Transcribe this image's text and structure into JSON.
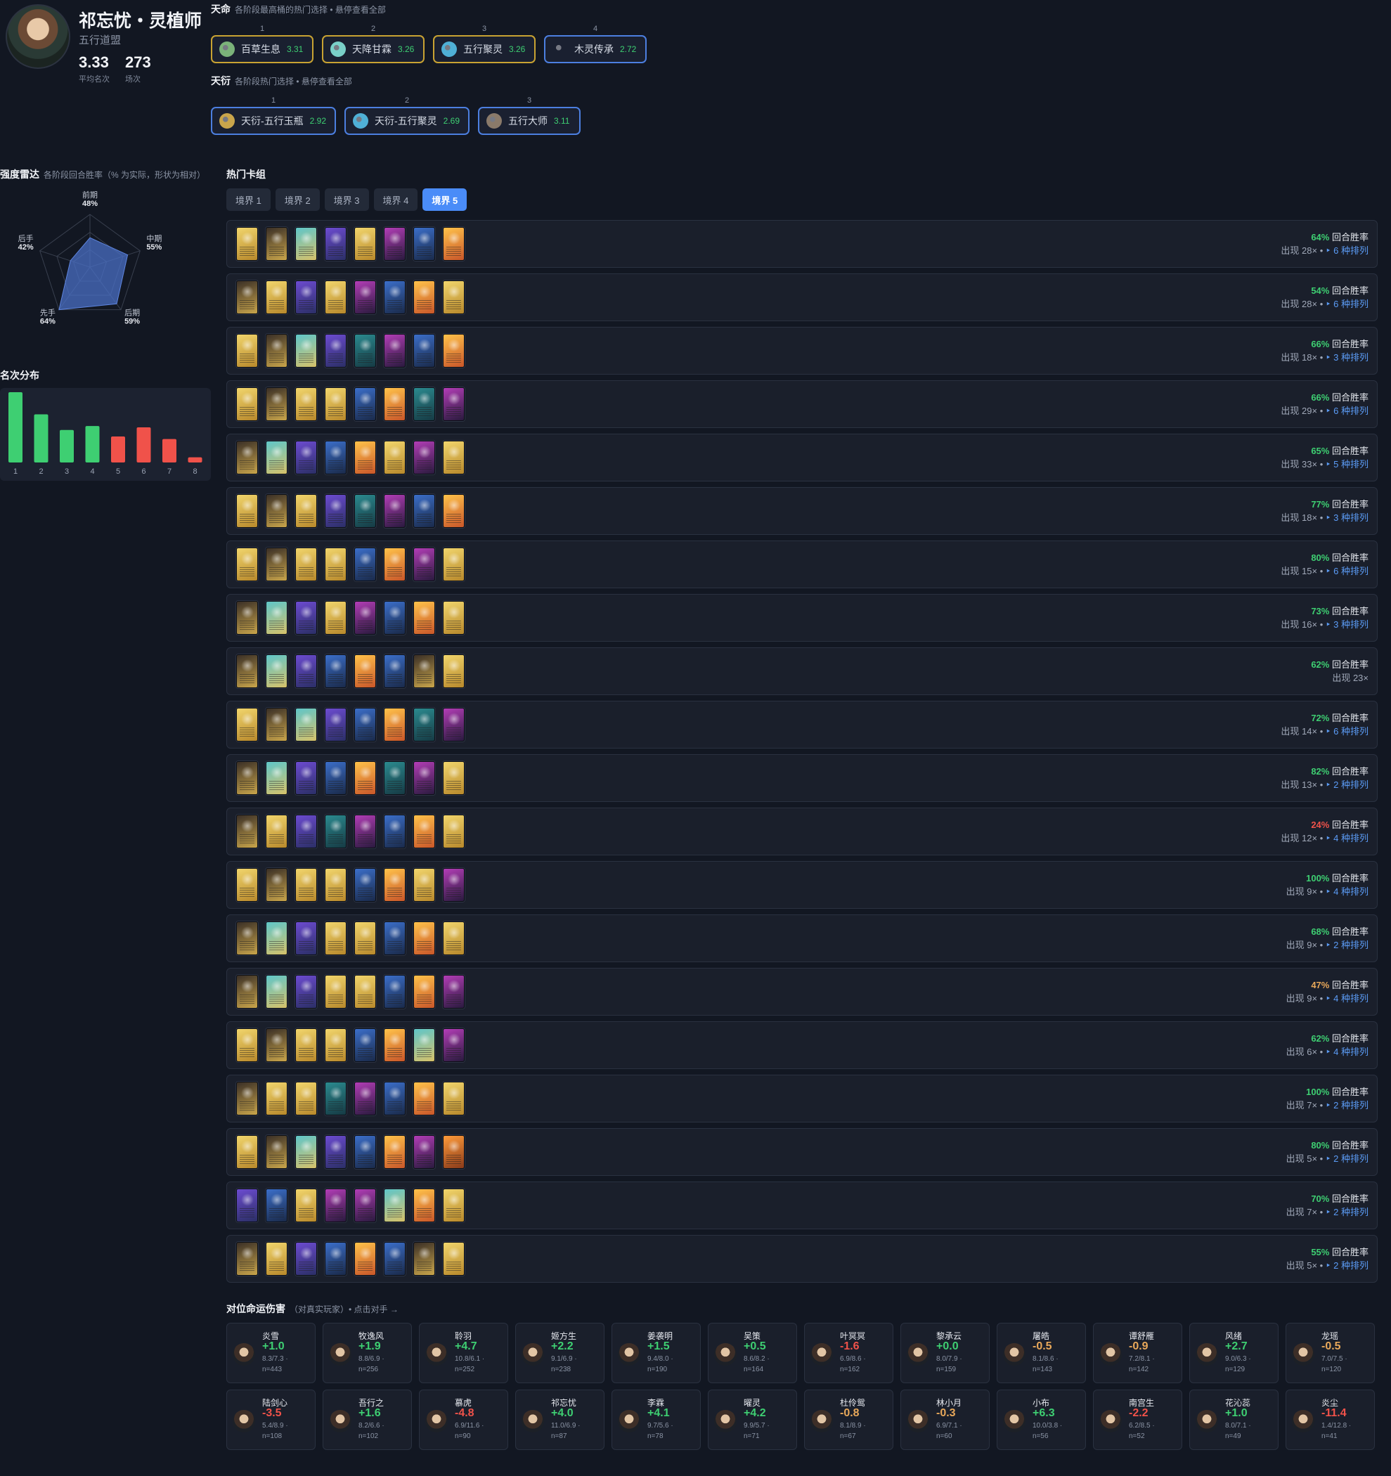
{
  "header": {
    "name": "祁忘忧・灵植师",
    "faction": "五行道盟",
    "avg_rank": "3.33",
    "avg_rank_label": "平均名次",
    "games": "273",
    "games_label": "场次"
  },
  "tianming": {
    "title": "天命",
    "subtitle": "各阶段最高桶的热门选择 • 悬停查看全部",
    "picks": [
      {
        "num": "1",
        "name": "百草生息",
        "score": "3.31",
        "icon": "herb-icon",
        "color": "#7bb37a"
      },
      {
        "num": "2",
        "name": "天降甘霖",
        "score": "3.26",
        "icon": "rain-icon",
        "color": "#7ad0c8"
      },
      {
        "num": "3",
        "name": "五行聚灵",
        "score": "3.26",
        "icon": "five-elements-icon",
        "color": "#4fb0d6"
      },
      {
        "num": "4",
        "name": "木灵传承",
        "score": "2.72",
        "icon": "wood-spirit-icon",
        "color": "#1a2030"
      }
    ]
  },
  "tianyan": {
    "title": "天衍",
    "subtitle": "各阶段热门选择 • 悬停查看全部",
    "picks": [
      {
        "num": "1",
        "name": "天衍-五行玉瓶",
        "score": "2.92",
        "icon": "jade-bottle-icon",
        "color": "#c9a54b"
      },
      {
        "num": "2",
        "name": "天衍-五行聚灵",
        "score": "2.69",
        "icon": "five-elements-icon",
        "color": "#4fb0d6"
      },
      {
        "num": "3",
        "name": "五行大师",
        "score": "3.11",
        "icon": "master-icon",
        "color": "#8a7a6a"
      }
    ]
  },
  "radar": {
    "title": "强度雷达",
    "subtitle": "各阶段回合胜率（% 为实际，形状为相对）",
    "axes": [
      {
        "label": "前期",
        "value": 48,
        "pct": "48%"
      },
      {
        "label": "中期",
        "value": 55,
        "pct": "55%"
      },
      {
        "label": "后期",
        "value": 59,
        "pct": "59%"
      },
      {
        "label": "先手",
        "value": 64,
        "pct": "64%"
      },
      {
        "label": "后手",
        "value": 42,
        "pct": "42%"
      }
    ],
    "fill": "#4a6fc4"
  },
  "placement": {
    "title": "名次分布"
  },
  "chart_data": {
    "type": "bar",
    "categories": [
      "1",
      "2",
      "3",
      "4",
      "5",
      "6",
      "7",
      "8"
    ],
    "values": [
      54,
      37,
      25,
      28,
      20,
      27,
      18,
      4
    ],
    "colors": [
      "#3ecf72",
      "#3ecf72",
      "#3ecf72",
      "#3ecf72",
      "#f0524a",
      "#f0524a",
      "#f0524a",
      "#f0524a"
    ]
  },
  "decks": {
    "title": "热门卡组",
    "tabs": [
      "境界 1",
      "境界 2",
      "境界 3",
      "境界 4",
      "境界 5"
    ],
    "active_tab": 4,
    "winrate_label": "回合胜率",
    "rows": [
      {
        "winrate": "64%",
        "color": "#3ecf72",
        "appear": "出现 28× •",
        "variants": "‣ 6 种排列",
        "cards": [
          "gold",
          "dark",
          "cyan",
          "purple",
          "gold",
          "magenta",
          "blue",
          "flame"
        ]
      },
      {
        "winrate": "54%",
        "color": "#3ecf72",
        "appear": "出现 28× •",
        "variants": "‣ 6 种排列",
        "cards": [
          "dark",
          "gold",
          "purple",
          "gold",
          "magenta",
          "blue",
          "flame",
          "gold"
        ]
      },
      {
        "winrate": "66%",
        "color": "#3ecf72",
        "appear": "出现 18× •",
        "variants": "‣ 3 种排列",
        "cards": [
          "gold",
          "dark",
          "cyan",
          "purple",
          "teal",
          "magenta",
          "blue",
          "flame"
        ]
      },
      {
        "winrate": "66%",
        "color": "#3ecf72",
        "appear": "出现 29× •",
        "variants": "‣ 6 种排列",
        "cards": [
          "gold",
          "dark",
          "gold",
          "gold",
          "blue",
          "flame",
          "teal",
          "magenta"
        ]
      },
      {
        "winrate": "65%",
        "color": "#3ecf72",
        "appear": "出现 33× •",
        "variants": "‣ 5 种排列",
        "cards": [
          "dark",
          "cyan",
          "purple",
          "blue",
          "flame",
          "gold",
          "magenta",
          "gold"
        ]
      },
      {
        "winrate": "77%",
        "color": "#3ecf72",
        "appear": "出现 18× •",
        "variants": "‣ 3 种排列",
        "cards": [
          "gold",
          "dark",
          "gold",
          "purple",
          "teal",
          "magenta",
          "blue",
          "flame"
        ]
      },
      {
        "winrate": "80%",
        "color": "#3ecf72",
        "appear": "出现 15× •",
        "variants": "‣ 6 种排列",
        "cards": [
          "gold",
          "dark",
          "gold",
          "gold",
          "blue",
          "flame",
          "magenta",
          "gold"
        ]
      },
      {
        "winrate": "73%",
        "color": "#3ecf72",
        "appear": "出现 16× •",
        "variants": "‣ 3 种排列",
        "cards": [
          "dark",
          "cyan",
          "purple",
          "gold",
          "magenta",
          "blue",
          "flame",
          "gold"
        ]
      },
      {
        "winrate": "62%",
        "color": "#3ecf72",
        "appear": "出现 23×",
        "variants": "",
        "cards": [
          "dark",
          "cyan",
          "purple",
          "blue",
          "flame",
          "blue",
          "dark",
          "gold"
        ]
      },
      {
        "winrate": "72%",
        "color": "#3ecf72",
        "appear": "出现 14× •",
        "variants": "‣ 6 种排列",
        "cards": [
          "gold",
          "dark",
          "cyan",
          "purple",
          "blue",
          "flame",
          "teal",
          "magenta"
        ]
      },
      {
        "winrate": "82%",
        "color": "#3ecf72",
        "appear": "出现 13× •",
        "variants": "‣ 2 种排列",
        "cards": [
          "dark",
          "cyan",
          "purple",
          "blue",
          "flame",
          "teal",
          "magenta",
          "gold"
        ]
      },
      {
        "winrate": "24%",
        "color": "#f0524a",
        "appear": "出现 12× •",
        "variants": "‣ 4 种排列",
        "cards": [
          "dark",
          "gold",
          "purple",
          "teal",
          "magenta",
          "blue",
          "flame",
          "gold"
        ]
      },
      {
        "winrate": "100%",
        "color": "#3ecf72",
        "appear": "出现 9× •",
        "variants": "‣ 4 种排列",
        "cards": [
          "gold",
          "dark",
          "gold",
          "gold",
          "blue",
          "flame",
          "gold",
          "magenta"
        ]
      },
      {
        "winrate": "68%",
        "color": "#3ecf72",
        "appear": "出现 9× •",
        "variants": "‣ 2 种排列",
        "cards": [
          "dark",
          "cyan",
          "purple",
          "gold",
          "gold",
          "blue",
          "flame",
          "gold"
        ]
      },
      {
        "winrate": "47%",
        "color": "#e8a85a",
        "appear": "出现 9× •",
        "variants": "‣ 4 种排列",
        "cards": [
          "dark",
          "cyan",
          "purple",
          "gold",
          "gold",
          "blue",
          "flame",
          "magenta"
        ]
      },
      {
        "winrate": "62%",
        "color": "#3ecf72",
        "appear": "出现 6× •",
        "variants": "‣ 4 种排列",
        "cards": [
          "gold",
          "dark",
          "gold",
          "gold",
          "blue",
          "flame",
          "cyan",
          "magenta"
        ]
      },
      {
        "winrate": "100%",
        "color": "#3ecf72",
        "appear": "出现 7× •",
        "variants": "‣ 2 种排列",
        "cards": [
          "dark",
          "gold",
          "gold",
          "teal",
          "magenta",
          "blue",
          "flame",
          "gold"
        ]
      },
      {
        "winrate": "80%",
        "color": "#3ecf72",
        "appear": "出现 5× •",
        "variants": "‣ 2 种排列",
        "cards": [
          "gold",
          "dark",
          "cyan",
          "purple",
          "blue",
          "flame",
          "magenta",
          "orange"
        ]
      },
      {
        "winrate": "70%",
        "color": "#3ecf72",
        "appear": "出现 7× •",
        "variants": "‣ 2 种排列",
        "cards": [
          "purple",
          "blue",
          "gold",
          "magenta",
          "magenta",
          "cyan",
          "flame",
          "gold"
        ]
      },
      {
        "winrate": "55%",
        "color": "#3ecf72",
        "appear": "出现 5× •",
        "variants": "‣ 2 种排列",
        "cards": [
          "dark",
          "gold",
          "purple",
          "blue",
          "flame",
          "blue",
          "dark",
          "gold"
        ]
      }
    ]
  },
  "matchups": {
    "title": "对位命运伤害",
    "subtitle": "（对真实玩家）• 点击对手 →",
    "items": [
      {
        "name": "炎雪",
        "delta": "+1.0",
        "color": "#3ecf72",
        "ex": "8.3/7.3 ·",
        "n": "n=443"
      },
      {
        "name": "牧逸风",
        "delta": "+1.9",
        "color": "#3ecf72",
        "ex": "8.8/6.9 ·",
        "n": "n=256"
      },
      {
        "name": "聆羽",
        "delta": "+4.7",
        "color": "#3ecf72",
        "ex": "10.8/6.1 ·",
        "n": "n=252"
      },
      {
        "name": "姬方生",
        "delta": "+2.2",
        "color": "#3ecf72",
        "ex": "9.1/6.9 ·",
        "n": "n=238"
      },
      {
        "name": "姜袭明",
        "delta": "+1.5",
        "color": "#3ecf72",
        "ex": "9.4/8.0 ·",
        "n": "n=190"
      },
      {
        "name": "吴策",
        "delta": "+0.5",
        "color": "#3ecf72",
        "ex": "8.6/8.2 ·",
        "n": "n=164"
      },
      {
        "name": "叶冥冥",
        "delta": "-1.6",
        "color": "#f0524a",
        "ex": "6.9/8.6 ·",
        "n": "n=162"
      },
      {
        "name": "黎承云",
        "delta": "+0.0",
        "color": "#3ecf72",
        "ex": "8.0/7.9 ·",
        "n": "n=159"
      },
      {
        "name": "屠皓",
        "delta": "-0.5",
        "color": "#e8a85a",
        "ex": "8.1/8.6 ·",
        "n": "n=143"
      },
      {
        "name": "谭舒雁",
        "delta": "-0.9",
        "color": "#e8a85a",
        "ex": "7.2/8.1 ·",
        "n": "n=142"
      },
      {
        "name": "风绪",
        "delta": "+2.7",
        "color": "#3ecf72",
        "ex": "9.0/6.3 ·",
        "n": "n=129"
      },
      {
        "name": "龙瑶",
        "delta": "-0.5",
        "color": "#e8a85a",
        "ex": "7.0/7.5 ·",
        "n": "n=120"
      },
      {
        "name": "陆剑心",
        "delta": "-3.5",
        "color": "#f0524a",
        "ex": "5.4/8.9 ·",
        "n": "n=108"
      },
      {
        "name": "吾行之",
        "delta": "+1.6",
        "color": "#3ecf72",
        "ex": "8.2/6.6 ·",
        "n": "n=102"
      },
      {
        "name": "慕虎",
        "delta": "-4.8",
        "color": "#f0524a",
        "ex": "6.9/11.6 ·",
        "n": "n=90"
      },
      {
        "name": "祁忘忧",
        "delta": "+4.0",
        "color": "#3ecf72",
        "ex": "11.0/6.9 ·",
        "n": "n=87"
      },
      {
        "name": "李霖",
        "delta": "+4.1",
        "color": "#3ecf72",
        "ex": "9.7/5.6 ·",
        "n": "n=78"
      },
      {
        "name": "曜灵",
        "delta": "+4.2",
        "color": "#3ecf72",
        "ex": "9.9/5.7 ·",
        "n": "n=71"
      },
      {
        "name": "杜伶鸳",
        "delta": "-0.8",
        "color": "#e8a85a",
        "ex": "8.1/8.9 ·",
        "n": "n=67"
      },
      {
        "name": "林小月",
        "delta": "-0.3",
        "color": "#e8a85a",
        "ex": "6.9/7.1 ·",
        "n": "n=60"
      },
      {
        "name": "小布",
        "delta": "+6.3",
        "color": "#3ecf72",
        "ex": "10.0/3.8 ·",
        "n": "n=56"
      },
      {
        "name": "南宫生",
        "delta": "-2.2",
        "color": "#f0524a",
        "ex": "6.2/8.5 ·",
        "n": "n=52"
      },
      {
        "name": "花沁蕊",
        "delta": "+1.0",
        "color": "#3ecf72",
        "ex": "8.0/7.1 ·",
        "n": "n=49"
      },
      {
        "name": "炎尘",
        "delta": "-11.4",
        "color": "#f0524a",
        "ex": "1.4/12.8 ·",
        "n": "n=41"
      }
    ]
  }
}
